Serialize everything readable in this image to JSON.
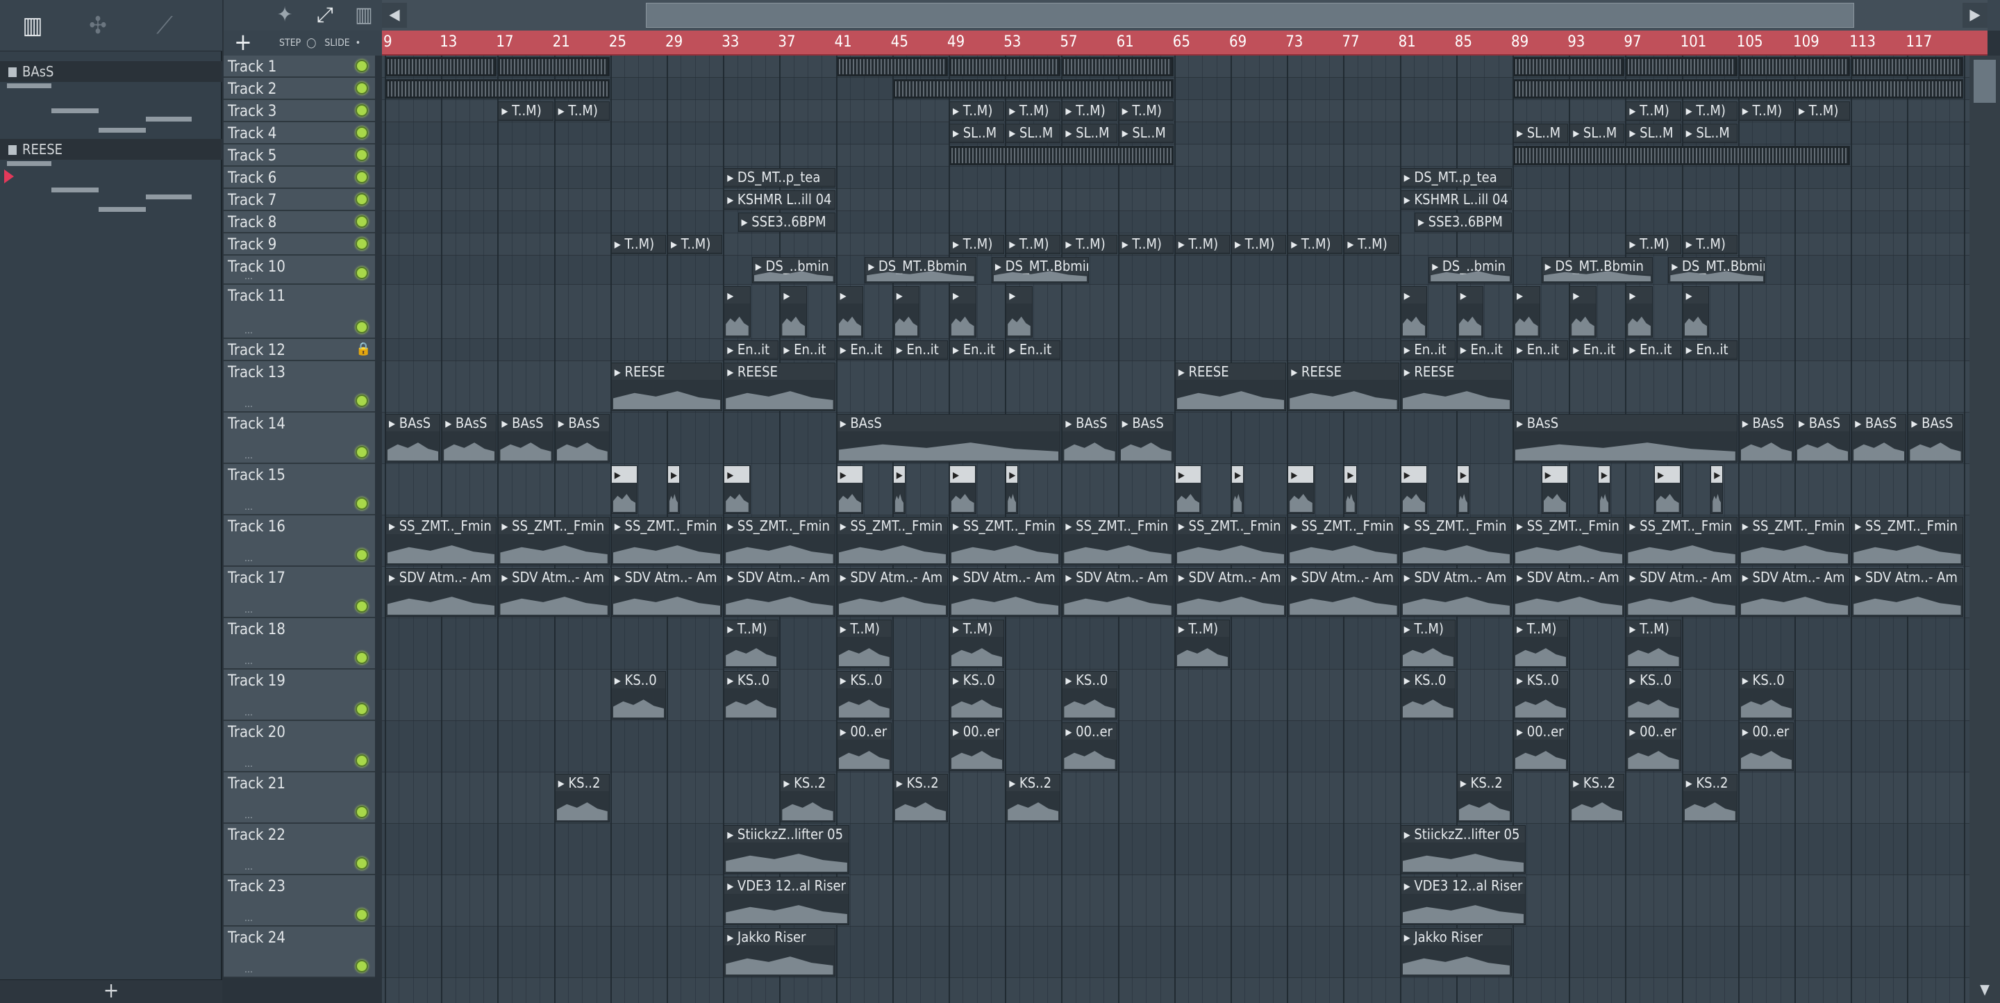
{
  "browser": {
    "tool_icons": [
      "piano-roll-icon",
      "automation-icon",
      "draw-icon"
    ],
    "clips": [
      {
        "label": "BAsS"
      },
      {
        "label": "REESE"
      }
    ],
    "add_label": "+"
  },
  "toolbar": {
    "add_label": "+",
    "step_label": "STEP",
    "slide_label": "SLIDE"
  },
  "ruler": {
    "bars": [
      "9",
      "13",
      "17",
      "21",
      "25",
      "29",
      "33",
      "37",
      "41",
      "45",
      "49",
      "53",
      "57",
      "61",
      "65",
      "69",
      "73",
      "77",
      "81",
      "85",
      "89",
      "93",
      "97",
      "101",
      "105",
      "109",
      "113",
      "117"
    ]
  },
  "tracks": [
    {
      "name": "Track 1"
    },
    {
      "name": "Track 2"
    },
    {
      "name": "Track 3"
    },
    {
      "name": "Track 4"
    },
    {
      "name": "Track 5"
    },
    {
      "name": "Track 6"
    },
    {
      "name": "Track 7"
    },
    {
      "name": "Track 8"
    },
    {
      "name": "Track 9"
    },
    {
      "name": "Track 10"
    },
    {
      "name": "Track 11"
    },
    {
      "name": "Track 12"
    },
    {
      "name": "Track 13"
    },
    {
      "name": "Track 14"
    },
    {
      "name": "Track 15"
    },
    {
      "name": "Track 16"
    },
    {
      "name": "Track 17"
    },
    {
      "name": "Track 18"
    },
    {
      "name": "Track 19"
    },
    {
      "name": "Track 20"
    },
    {
      "name": "Track 21"
    },
    {
      "name": "Track 22"
    },
    {
      "name": "Track 23"
    },
    {
      "name": "Track 24"
    }
  ],
  "track_dots": "...",
  "clips": [
    {
      "track": 3,
      "start": 17,
      "len": 4,
      "label": "T..M)"
    },
    {
      "track": 3,
      "start": 21,
      "len": 4,
      "label": "T..M)"
    },
    {
      "track": 3,
      "start": 49,
      "len": 4,
      "label": "T..M)"
    },
    {
      "track": 3,
      "start": 53,
      "len": 4,
      "label": "T..M)"
    },
    {
      "track": 3,
      "start": 57,
      "len": 4,
      "label": "T..M)"
    },
    {
      "track": 3,
      "start": 61,
      "len": 4,
      "label": "T..M)"
    },
    {
      "track": 3,
      "start": 97,
      "len": 4,
      "label": "T..M)"
    },
    {
      "track": 3,
      "start": 101,
      "len": 4,
      "label": "T..M)"
    },
    {
      "track": 3,
      "start": 105,
      "len": 4,
      "label": "T..M)"
    },
    {
      "track": 3,
      "start": 109,
      "len": 4,
      "label": "T..M)"
    },
    {
      "track": 4,
      "start": 49,
      "len": 4,
      "label": "SL..M"
    },
    {
      "track": 4,
      "start": 53,
      "len": 4,
      "label": "SL..M"
    },
    {
      "track": 4,
      "start": 57,
      "len": 4,
      "label": "SL..M"
    },
    {
      "track": 4,
      "start": 61,
      "len": 4,
      "label": "SL..M"
    },
    {
      "track": 4,
      "start": 89,
      "len": 4,
      "label": "SL..M"
    },
    {
      "track": 4,
      "start": 93,
      "len": 4,
      "label": "SL..M"
    },
    {
      "track": 4,
      "start": 97,
      "len": 4,
      "label": "SL..M"
    },
    {
      "track": 4,
      "start": 101,
      "len": 4,
      "label": "SL..M"
    },
    {
      "track": 6,
      "start": 33,
      "len": 8,
      "label": "DS_MT..p_tea"
    },
    {
      "track": 6,
      "start": 81,
      "len": 8,
      "label": "DS_MT..p_tea"
    },
    {
      "track": 7,
      "start": 33,
      "len": 8,
      "label": "KSHMR L..ill 04"
    },
    {
      "track": 7,
      "start": 81,
      "len": 8,
      "label": "KSHMR L..ill 04"
    },
    {
      "track": 8,
      "start": 34,
      "len": 7,
      "label": "SSE3..6BPM"
    },
    {
      "track": 8,
      "start": 82,
      "len": 7,
      "label": "SSE3..6BPM"
    },
    {
      "track": 9,
      "start": 25,
      "len": 4,
      "label": "T..M)"
    },
    {
      "track": 9,
      "start": 29,
      "len": 4,
      "label": "T..M)"
    },
    {
      "track": 9,
      "start": 49,
      "len": 4,
      "label": "T..M)"
    },
    {
      "track": 9,
      "start": 53,
      "len": 4,
      "label": "T..M)"
    },
    {
      "track": 9,
      "start": 57,
      "len": 4,
      "label": "T..M)"
    },
    {
      "track": 9,
      "start": 61,
      "len": 4,
      "label": "T..M)"
    },
    {
      "track": 9,
      "start": 65,
      "len": 4,
      "label": "T..M)"
    },
    {
      "track": 9,
      "start": 69,
      "len": 4,
      "label": "T..M)"
    },
    {
      "track": 9,
      "start": 73,
      "len": 4,
      "label": "T..M)"
    },
    {
      "track": 9,
      "start": 77,
      "len": 4,
      "label": "T..M)"
    },
    {
      "track": 9,
      "start": 97,
      "len": 4,
      "label": "T..M)"
    },
    {
      "track": 9,
      "start": 101,
      "len": 4,
      "label": "T..M)"
    },
    {
      "track": 10,
      "start": 35,
      "len": 6,
      "label": "DS_..bmin"
    },
    {
      "track": 10,
      "start": 43,
      "len": 8,
      "label": "DS_MT..Bbmin"
    },
    {
      "track": 10,
      "start": 52,
      "len": 7,
      "label": "DS_MT..Bbmin"
    },
    {
      "track": 10,
      "start": 83,
      "len": 6,
      "label": "DS_..bmin"
    },
    {
      "track": 10,
      "start": 91,
      "len": 8,
      "label": "DS_MT..Bbmin"
    },
    {
      "track": 10,
      "start": 100,
      "len": 7,
      "label": "DS_MT..Bbmin"
    },
    {
      "track": 12,
      "start": 33,
      "len": 4,
      "label": "En..it"
    },
    {
      "track": 12,
      "start": 37,
      "len": 4,
      "label": "En..it"
    },
    {
      "track": 12,
      "start": 41,
      "len": 4,
      "label": "En..it"
    },
    {
      "track": 12,
      "start": 45,
      "len": 4,
      "label": "En..it"
    },
    {
      "track": 12,
      "start": 49,
      "len": 4,
      "label": "En..it"
    },
    {
      "track": 12,
      "start": 53,
      "len": 4,
      "label": "En..it"
    },
    {
      "track": 12,
      "start": 81,
      "len": 4,
      "label": "En..it"
    },
    {
      "track": 12,
      "start": 85,
      "len": 4,
      "label": "En..it"
    },
    {
      "track": 12,
      "start": 89,
      "len": 4,
      "label": "En..it"
    },
    {
      "track": 12,
      "start": 93,
      "len": 4,
      "label": "En..it"
    },
    {
      "track": 12,
      "start": 97,
      "len": 4,
      "label": "En..it"
    },
    {
      "track": 12,
      "start": 101,
      "len": 4,
      "label": "En..it"
    },
    {
      "track": 13,
      "start": 25,
      "len": 8,
      "label": "REESE"
    },
    {
      "track": 13,
      "start": 33,
      "len": 8,
      "label": "REESE"
    },
    {
      "track": 13,
      "start": 65,
      "len": 8,
      "label": "REESE"
    },
    {
      "track": 13,
      "start": 73,
      "len": 8,
      "label": "REESE"
    },
    {
      "track": 13,
      "start": 81,
      "len": 8,
      "label": "REESE"
    },
    {
      "track": 14,
      "start": 9,
      "len": 4,
      "label": "BAsS"
    },
    {
      "track": 14,
      "start": 13,
      "len": 4,
      "label": "BAsS"
    },
    {
      "track": 14,
      "start": 17,
      "len": 4,
      "label": "BAsS"
    },
    {
      "track": 14,
      "start": 21,
      "len": 4,
      "label": "BAsS"
    },
    {
      "track": 14,
      "start": 41,
      "len": 16,
      "label": "BAsS"
    },
    {
      "track": 14,
      "start": 57,
      "len": 4,
      "label": "BAsS"
    },
    {
      "track": 14,
      "start": 61,
      "len": 4,
      "label": "BAsS"
    },
    {
      "track": 14,
      "start": 89,
      "len": 16,
      "label": "BAsS"
    },
    {
      "track": 14,
      "start": 105,
      "len": 4,
      "label": "BAsS"
    },
    {
      "track": 14,
      "start": 109,
      "len": 4,
      "label": "BAsS"
    },
    {
      "track": 14,
      "start": 113,
      "len": 4,
      "label": "BAsS"
    },
    {
      "track": 14,
      "start": 117,
      "len": 4,
      "label": "BAsS"
    },
    {
      "track": 16,
      "start": 9,
      "len": 8,
      "label": "SS_ZMT.._Fmin"
    },
    {
      "track": 16,
      "start": 17,
      "len": 8,
      "label": "SS_ZMT.._Fmin"
    },
    {
      "track": 16,
      "start": 25,
      "len": 8,
      "label": "SS_ZMT.._Fmin"
    },
    {
      "track": 16,
      "start": 33,
      "len": 8,
      "label": "SS_ZMT.._Fmin"
    },
    {
      "track": 16,
      "start": 41,
      "len": 8,
      "label": "SS_ZMT.._Fmin"
    },
    {
      "track": 16,
      "start": 49,
      "len": 8,
      "label": "SS_ZMT.._Fmin"
    },
    {
      "track": 16,
      "start": 57,
      "len": 8,
      "label": "SS_ZMT.._Fmin"
    },
    {
      "track": 16,
      "start": 65,
      "len": 8,
      "label": "SS_ZMT.._Fmin"
    },
    {
      "track": 16,
      "start": 73,
      "len": 8,
      "label": "SS_ZMT.._Fmin"
    },
    {
      "track": 16,
      "start": 81,
      "len": 8,
      "label": "SS_ZMT.._Fmin"
    },
    {
      "track": 16,
      "start": 89,
      "len": 8,
      "label": "SS_ZMT.._Fmin"
    },
    {
      "track": 16,
      "start": 97,
      "len": 8,
      "label": "SS_ZMT.._Fmin"
    },
    {
      "track": 16,
      "start": 105,
      "len": 8,
      "label": "SS_ZMT.._Fmin"
    },
    {
      "track": 16,
      "start": 113,
      "len": 8,
      "label": "SS_ZMT.._Fmin"
    },
    {
      "track": 17,
      "start": 9,
      "len": 8,
      "label": "SDV Atm..- Am"
    },
    {
      "track": 17,
      "start": 17,
      "len": 8,
      "label": "SDV Atm..- Am"
    },
    {
      "track": 17,
      "start": 25,
      "len": 8,
      "label": "SDV Atm..- Am"
    },
    {
      "track": 17,
      "start": 33,
      "len": 8,
      "label": "SDV Atm..- Am"
    },
    {
      "track": 17,
      "start": 41,
      "len": 8,
      "label": "SDV Atm..- Am"
    },
    {
      "track": 17,
      "start": 49,
      "len": 8,
      "label": "SDV Atm..- Am"
    },
    {
      "track": 17,
      "start": 57,
      "len": 8,
      "label": "SDV Atm..- Am"
    },
    {
      "track": 17,
      "start": 65,
      "len": 8,
      "label": "SDV Atm..- Am"
    },
    {
      "track": 17,
      "start": 73,
      "len": 8,
      "label": "SDV Atm..- Am"
    },
    {
      "track": 17,
      "start": 81,
      "len": 8,
      "label": "SDV Atm..- Am"
    },
    {
      "track": 17,
      "start": 89,
      "len": 8,
      "label": "SDV Atm..- Am"
    },
    {
      "track": 17,
      "start": 97,
      "len": 8,
      "label": "SDV Atm..- Am"
    },
    {
      "track": 17,
      "start": 105,
      "len": 8,
      "label": "SDV Atm..- Am"
    },
    {
      "track": 17,
      "start": 113,
      "len": 8,
      "label": "SDV Atm..- Am"
    },
    {
      "track": 18,
      "start": 33,
      "len": 4,
      "label": "T..M)"
    },
    {
      "track": 18,
      "start": 41,
      "len": 4,
      "label": "T..M)"
    },
    {
      "track": 18,
      "start": 49,
      "len": 4,
      "label": "T..M)"
    },
    {
      "track": 18,
      "start": 65,
      "len": 4,
      "label": "T..M)"
    },
    {
      "track": 18,
      "start": 81,
      "len": 4,
      "label": "T..M)"
    },
    {
      "track": 18,
      "start": 89,
      "len": 4,
      "label": "T..M)"
    },
    {
      "track": 18,
      "start": 97,
      "len": 4,
      "label": "T..M)"
    },
    {
      "track": 19,
      "start": 25,
      "len": 4,
      "label": "KS..0"
    },
    {
      "track": 19,
      "start": 33,
      "len": 4,
      "label": "KS..0"
    },
    {
      "track": 19,
      "start": 41,
      "len": 4,
      "label": "KS..0"
    },
    {
      "track": 19,
      "start": 49,
      "len": 4,
      "label": "KS..0"
    },
    {
      "track": 19,
      "start": 57,
      "len": 4,
      "label": "KS..0"
    },
    {
      "track": 19,
      "start": 81,
      "len": 4,
      "label": "KS..0"
    },
    {
      "track": 19,
      "start": 89,
      "len": 4,
      "label": "KS..0"
    },
    {
      "track": 19,
      "start": 97,
      "len": 4,
      "label": "KS..0"
    },
    {
      "track": 19,
      "start": 105,
      "len": 4,
      "label": "KS..0"
    },
    {
      "track": 20,
      "start": 41,
      "len": 4,
      "label": "00..er"
    },
    {
      "track": 20,
      "start": 49,
      "len": 4,
      "label": "00..er"
    },
    {
      "track": 20,
      "start": 57,
      "len": 4,
      "label": "00..er"
    },
    {
      "track": 20,
      "start": 89,
      "len": 4,
      "label": "00..er"
    },
    {
      "track": 20,
      "start": 97,
      "len": 4,
      "label": "00..er"
    },
    {
      "track": 20,
      "start": 105,
      "len": 4,
      "label": "00..er"
    },
    {
      "track": 21,
      "start": 21,
      "len": 4,
      "label": "KS..2"
    },
    {
      "track": 21,
      "start": 37,
      "len": 4,
      "label": "KS..2"
    },
    {
      "track": 21,
      "start": 45,
      "len": 4,
      "label": "KS..2"
    },
    {
      "track": 21,
      "start": 53,
      "len": 4,
      "label": "KS..2"
    },
    {
      "track": 21,
      "start": 85,
      "len": 4,
      "label": "KS..2"
    },
    {
      "track": 21,
      "start": 93,
      "len": 4,
      "label": "KS..2"
    },
    {
      "track": 21,
      "start": 101,
      "len": 4,
      "label": "KS..2"
    },
    {
      "track": 22,
      "start": 33,
      "len": 9,
      "label": "StiickzZ..lifter 05"
    },
    {
      "track": 22,
      "start": 81,
      "len": 9,
      "label": "StiickzZ..lifter 05"
    },
    {
      "track": 23,
      "start": 33,
      "len": 9,
      "label": "VDE3 12..al Riser"
    },
    {
      "track": 23,
      "start": 81,
      "len": 9,
      "label": "VDE3 12..al Riser"
    },
    {
      "track": 24,
      "start": 33,
      "len": 8,
      "label": "Jakko Riser"
    },
    {
      "track": 24,
      "start": 81,
      "len": 8,
      "label": "Jakko Riser"
    }
  ],
  "unlabeled_clips": [
    {
      "track": 1,
      "start": 9,
      "len": 8,
      "style": "dense"
    },
    {
      "track": 1,
      "start": 17,
      "len": 8,
      "style": "dense"
    },
    {
      "track": 1,
      "start": 41,
      "len": 8,
      "style": "dense"
    },
    {
      "track": 1,
      "start": 49,
      "len": 8,
      "style": "dense"
    },
    {
      "track": 1,
      "start": 57,
      "len": 8,
      "style": "dense"
    },
    {
      "track": 1,
      "start": 89,
      "len": 8,
      "style": "dense"
    },
    {
      "track": 1,
      "start": 97,
      "len": 8,
      "style": "dense"
    },
    {
      "track": 1,
      "start": 105,
      "len": 8,
      "style": "dense"
    },
    {
      "track": 1,
      "start": 113,
      "len": 8,
      "style": "dense"
    },
    {
      "track": 2,
      "start": 9,
      "len": 16,
      "style": "dense"
    },
    {
      "track": 2,
      "start": 45,
      "len": 20,
      "style": "dense"
    },
    {
      "track": 2,
      "start": 89,
      "len": 32,
      "style": "dense"
    },
    {
      "track": 5,
      "start": 49,
      "len": 16,
      "style": "dense"
    },
    {
      "track": 5,
      "start": 89,
      "len": 24,
      "style": "dense"
    },
    {
      "track": 11,
      "start": 33,
      "len": 2,
      "style": "hit"
    },
    {
      "track": 11,
      "start": 37,
      "len": 2,
      "style": "hit"
    },
    {
      "track": 11,
      "start": 41,
      "len": 2,
      "style": "hit"
    },
    {
      "track": 11,
      "start": 45,
      "len": 2,
      "style": "hit"
    },
    {
      "track": 11,
      "start": 49,
      "len": 2,
      "style": "hit"
    },
    {
      "track": 11,
      "start": 53,
      "len": 2,
      "style": "hit"
    },
    {
      "track": 11,
      "start": 81,
      "len": 2,
      "style": "hit"
    },
    {
      "track": 11,
      "start": 85,
      "len": 2,
      "style": "hit"
    },
    {
      "track": 11,
      "start": 89,
      "len": 2,
      "style": "hit"
    },
    {
      "track": 11,
      "start": 93,
      "len": 2,
      "style": "hit"
    },
    {
      "track": 11,
      "start": 97,
      "len": 2,
      "style": "hit"
    },
    {
      "track": 11,
      "start": 101,
      "len": 2,
      "style": "hit"
    },
    {
      "track": 15,
      "start": 25,
      "len": 2,
      "style": "white"
    },
    {
      "track": 15,
      "start": 29,
      "len": 1,
      "style": "white"
    },
    {
      "track": 15,
      "start": 33,
      "len": 2,
      "style": "white"
    },
    {
      "track": 15,
      "start": 41,
      "len": 2,
      "style": "white"
    },
    {
      "track": 15,
      "start": 45,
      "len": 1,
      "style": "white"
    },
    {
      "track": 15,
      "start": 49,
      "len": 2,
      "style": "white"
    },
    {
      "track": 15,
      "start": 53,
      "len": 1,
      "style": "white"
    },
    {
      "track": 15,
      "start": 65,
      "len": 2,
      "style": "white"
    },
    {
      "track": 15,
      "start": 69,
      "len": 1,
      "style": "white"
    },
    {
      "track": 15,
      "start": 73,
      "len": 2,
      "style": "white"
    },
    {
      "track": 15,
      "start": 77,
      "len": 1,
      "style": "white"
    },
    {
      "track": 15,
      "start": 81,
      "len": 2,
      "style": "white"
    },
    {
      "track": 15,
      "start": 85,
      "len": 1,
      "style": "white"
    },
    {
      "track": 15,
      "start": 91,
      "len": 2,
      "style": "white"
    },
    {
      "track": 15,
      "start": 95,
      "len": 1,
      "style": "white"
    },
    {
      "track": 15,
      "start": 99,
      "len": 2,
      "style": "white"
    },
    {
      "track": 15,
      "start": 103,
      "len": 1,
      "style": "white"
    }
  ],
  "colors": {
    "ruler": "#c0505a",
    "led": "#a8d84a",
    "grid_bg": "#3a4650",
    "clip_bg": "#2c353c"
  }
}
